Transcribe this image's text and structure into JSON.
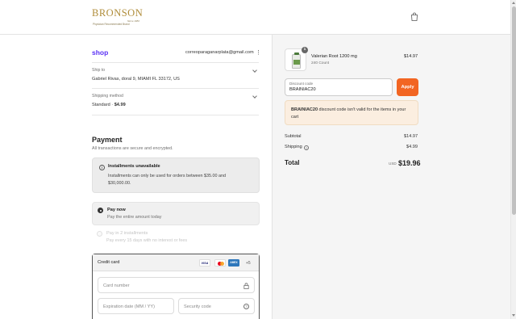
{
  "header": {
    "logo_word": "BRONSON",
    "logo_since": "Since 1982",
    "logo_tagline": "Physician Recommended Brand"
  },
  "account": {
    "shop_label": "shop",
    "email": "correoparaganarplata@gmail.com"
  },
  "ship_to": {
    "label": "Ship to",
    "value": "Gabriel Rivas, doral 9, MIAMI FL 33172, US"
  },
  "shipping_method": {
    "label": "Shipping method",
    "value_name": "Standard",
    "value_sep": " · ",
    "value_price": "$4.99"
  },
  "payment": {
    "title": "Payment",
    "subtitle": "All transactions are secure and encrypted.",
    "notice_title": "Installments unavailable",
    "notice_text": "Installments can only be used for orders between $35.00 and $30,000.00.",
    "options": [
      {
        "title": "Pay now",
        "desc": "Pay the entire amount today",
        "selected": true
      },
      {
        "title": "Pay in 2 installments",
        "desc": "Pay every 15 days with no interest or fees",
        "selected": false
      }
    ],
    "credit_card": {
      "label": "Credit card",
      "cards": [
        "VISA",
        "mastercard",
        "AMERICAN EXPRESS"
      ],
      "more": "+5",
      "card_number_placeholder": "Card number",
      "expiration_placeholder": "Expiration date (MM / YY)",
      "security_placeholder": "Security code"
    }
  },
  "order": {
    "item": {
      "name": "Valerian Root 1200 mg",
      "variant": "240 Count",
      "qty": "1",
      "price": "$14.97"
    },
    "discount": {
      "placeholder": "Discount code",
      "value": "BRAINIAC20",
      "apply_label": "Apply",
      "error_code": "BRAINIAC20",
      "error_text": " discount code isn't valid for the items in your cart"
    },
    "summary": {
      "subtotal_label": "Subtotal",
      "subtotal_value": "$14.97",
      "shipping_label": "Shipping",
      "shipping_value": "$4.99",
      "total_label": "Total",
      "total_currency": "USD",
      "total_value": "$19.96"
    }
  },
  "colors": {
    "accent_apply": "#f26522",
    "shop_purple": "#5a31f4",
    "logo_gold": "#b08d3a",
    "error_bg": "#fbeee0"
  }
}
